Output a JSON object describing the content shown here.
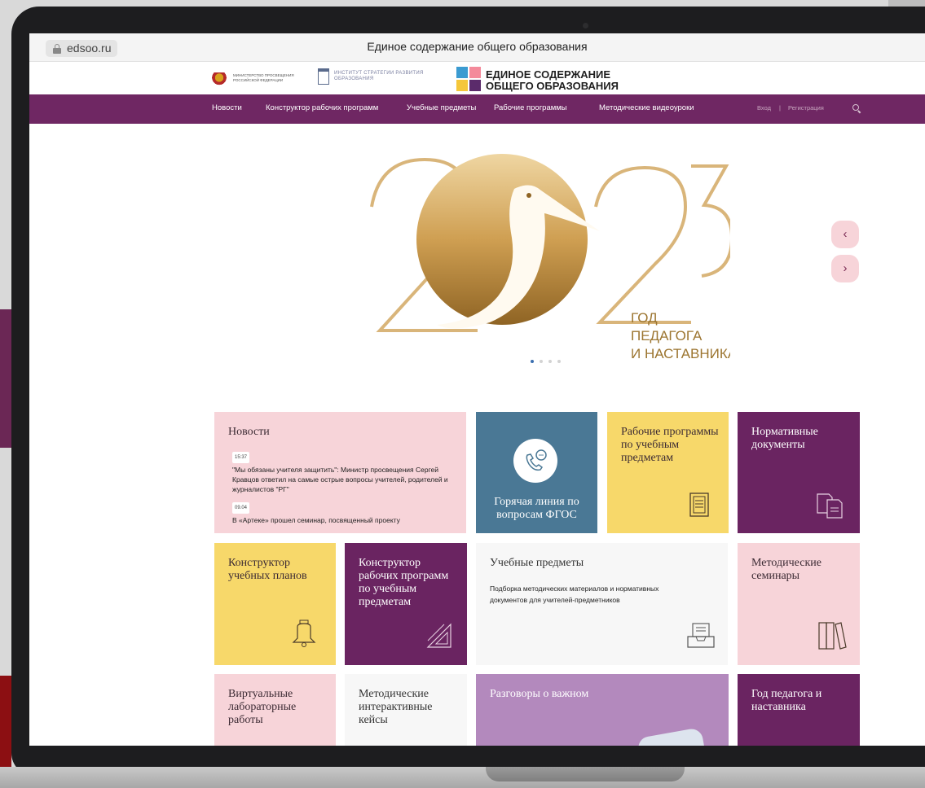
{
  "browser": {
    "url": "edsoo.ru",
    "page_title": "Единое содержание общего образования"
  },
  "header": {
    "ministry_logo_text": "МИНИСТЕРСТВО ПРОСВЕЩЕНИЯ РОССИЙСКОЙ ФЕДЕРАЦИИ",
    "institute_logo_text": "ИНСТИТУТ СТРАТЕГИИ РАЗВИТИЯ ОБРАЗОВАНИЯ",
    "site_name_line1": "ЕДИНОЕ СОДЕРЖАНИЕ",
    "site_name_line2": "ОБЩЕГО ОБРАЗОВАНИЯ"
  },
  "nav": {
    "items": [
      "Новости",
      "Конструктор рабочих программ",
      "Учебные предметы",
      "Рабочие программы",
      "Методические видеоуроки"
    ],
    "login": "Вход",
    "separator": "|",
    "register": "Регистрация"
  },
  "hero": {
    "year_left": "20",
    "year_right": "23",
    "caption_line1": "ГОД",
    "caption_line2": "ПЕДАГОГА",
    "caption_line3": "И НАСТАВНИКА",
    "prev_label": "‹",
    "next_label": "›",
    "slides_count": 4,
    "active_slide": 1
  },
  "tiles": {
    "news": {
      "title": "Новости",
      "items": [
        {
          "date": "15:37",
          "text": "\"Мы обязаны учителя защитить\": Министр просвещения Сергей Кравцов ответил на самые острые вопросы учителей, родителей и журналистов \"РГ\""
        },
        {
          "date": "09.04",
          "text": "В «Артеке» прошел семинар, посвященный проекту"
        }
      ]
    },
    "hotline": "Горячая линия по вопросам ФГОС",
    "work_programs": "Рабочие программы по учебным предметам",
    "normative_docs": "Нормативные документы",
    "curriculum_builder": "Конструктор учебных планов",
    "program_builder": "Конструктор рабочих программ по учебным предметам",
    "subjects": {
      "title": "Учебные предметы",
      "description": "Подборка методических материалов и нормативных документов для учителей-предметников"
    },
    "seminars": "Методические семинары",
    "virtual_labs": "Виртуальные лабораторные работы",
    "interactive_cases": "Методические интерактивные кейсы",
    "talks": "Разговоры о важном",
    "teacher_year": "Год педагога и наставника"
  },
  "colors": {
    "nav_purple": "#6f2763",
    "tile_pink": "#f7d4d9",
    "tile_blue": "#4a7895",
    "tile_yellow": "#f7d86a",
    "tile_purple": "#6a2461",
    "tile_lilac": "#b389bd",
    "tile_light": "#f7f7f7",
    "gold": "#d5aa5a"
  },
  "icons": [
    "lock-icon",
    "search-icon",
    "phone-chat-icon",
    "document-icon",
    "documents-icon",
    "bell-icon",
    "ruler-triangle-icon",
    "inbox-tray-icon",
    "books-icon"
  ]
}
